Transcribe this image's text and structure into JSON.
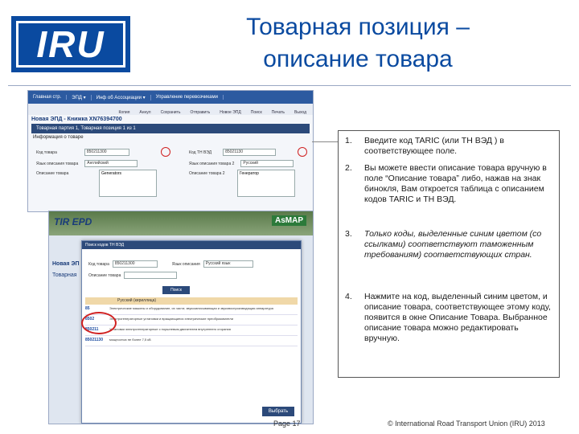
{
  "logo": {
    "text": "IRU"
  },
  "title": {
    "line1": "Товарная позиция –",
    "line2": "описание товара"
  },
  "screenshot1": {
    "nav": [
      "Главная стр.",
      "ЭПД ▾",
      "Инф об Ассоциации ▾",
      "Управление перевозчиками"
    ],
    "toolbar": [
      "Копия",
      "Аннул",
      "Сохранить",
      "Отправить",
      "Новое ЭПД",
      "Поиск",
      "Печать",
      "Выход"
    ],
    "doc_title": "Новая ЭПД - Книжка XN76394700",
    "doc_bar": "Товарная партия 1, Товарная позиция 1 из 1",
    "info_title": "Информация о товаре",
    "fields": {
      "code_label": "Код товара",
      "code_value": "850211300",
      "code_label_right": "Код ТН ВЭД",
      "code_value_right": "85021130",
      "lang_label": "Язык описания товара",
      "lang_value": "Английский",
      "lang_label_right": "Язык описания товара 2",
      "lang_value_right": "Русский",
      "desc_label": "Описание товара",
      "desc_value": "Generators",
      "desc_label_right": "Описание товара 2",
      "desc_value_right": "Генератор"
    }
  },
  "screenshot2": {
    "banner_left": "TIR EPD",
    "banner_right": "AsMAP",
    "bg_title": "Новая ЭП",
    "bg_bar": "Товарная",
    "modal_title": "Поиск кодов ТН ВЭД",
    "code_label": "Код товара",
    "code_value": "850211300",
    "lang_label": "Язык описания",
    "lang_value": "Русский язык",
    "desc_label": "Описание товара",
    "search_button": "Поиск",
    "result_header": "Русский (кириллица)",
    "results": [
      {
        "code": "85",
        "desc": "Электрические машины и оборудование, их части; звукозаписывающая и звуковоспроизводящая аппаратура"
      },
      {
        "code": "8502",
        "desc": "Электрогенераторные установки и вращающиеся электрические преобразователи"
      },
      {
        "code": "850211",
        "desc": "Установки электрогенераторные с поршневым двигателем внутреннего сгорания"
      },
      {
        "code": "85021130",
        "desc": "мощностью не более 7,5 кВ"
      }
    ],
    "choose_button": "Выбрать"
  },
  "callout": {
    "items": [
      {
        "num": "1.",
        "text": "Введите код TARIC (или ТН ВЭД ) в соответствующее поле."
      },
      {
        "num": "2.",
        "text": "Вы можете ввести описание товара вручную в поле “Описание товара” либо, нажав на знак бинокля, Вам откроется таблица с описанием кодов TARIC и ТН ВЭД."
      },
      {
        "num": "3.",
        "text": "Только коды, выделенные синим цветом (со ссылками) соответствуют таможенным требованиям) соответствующих стран."
      },
      {
        "num": "4.",
        "text": "Нажмите на код, выделенный синим цветом, и описание товара, соответствующее этому коду, появится в окне Описание Товара. Выбранное описание товара можно редактировать вручную."
      }
    ]
  },
  "footer": {
    "page": "Page 17",
    "copyright": "© International Road Transport Union (IRU) 2013"
  }
}
